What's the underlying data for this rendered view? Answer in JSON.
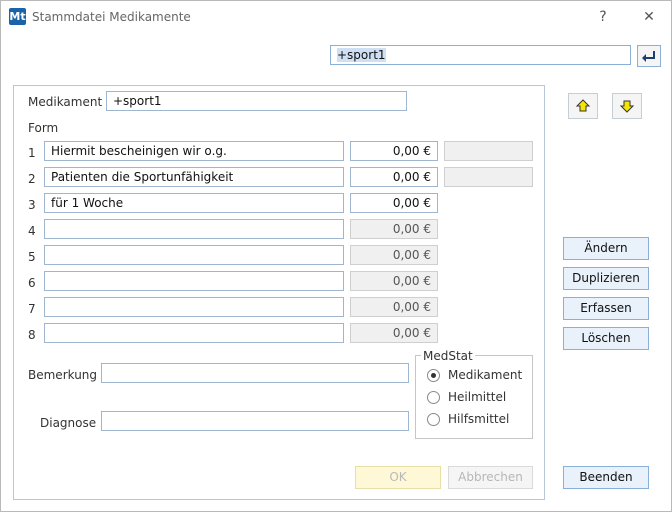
{
  "window": {
    "app_icon": "Mt",
    "title": "Stammdatei Medikamente",
    "help": "?",
    "close": "✕"
  },
  "search": {
    "value": "+sport1",
    "enter_icon": "return-arrow-icon"
  },
  "form": {
    "medikament_label": "Medikament",
    "medikament_value": "+sport1",
    "form_label": "Form",
    "rows": [
      {
        "num": "1",
        "text": "Hiermit bescheinigen wir o.g.",
        "price": "0,00 €"
      },
      {
        "num": "2",
        "text": "Patienten die Sportunfähigkeit",
        "price": "0,00 €"
      },
      {
        "num": "3",
        "text": "für 1 Woche",
        "price": "0,00 €"
      },
      {
        "num": "4",
        "text": "",
        "price": "0,00 €"
      },
      {
        "num": "5",
        "text": "",
        "price": "0,00 €"
      },
      {
        "num": "6",
        "text": "",
        "price": "0,00 €"
      },
      {
        "num": "7",
        "text": "",
        "price": "0,00 €"
      },
      {
        "num": "8",
        "text": "",
        "price": "0,00 €"
      }
    ],
    "bemerkung_label": "Bemerkung",
    "bemerkung_value": "",
    "diagnose_label": "Diagnose",
    "diagnose_value": "",
    "medstat": {
      "title": "MedStat",
      "options": [
        "Medikament",
        "Heilmittel",
        "Hilfsmittel"
      ],
      "selected": "Medikament"
    },
    "ok_label": "OK",
    "abbrechen_label": "Abbrechen"
  },
  "side": {
    "up_icon": "arrow-up-icon",
    "down_icon": "arrow-down-icon",
    "aendern": "Ändern",
    "duplizieren": "Duplizieren",
    "erfassen": "Erfassen",
    "loeschen": "Löschen",
    "beenden": "Beenden"
  },
  "colors": {
    "accent": "#1b63a8",
    "button_bg": "#e9f1fb",
    "arrow_fill": "#f5e600"
  }
}
